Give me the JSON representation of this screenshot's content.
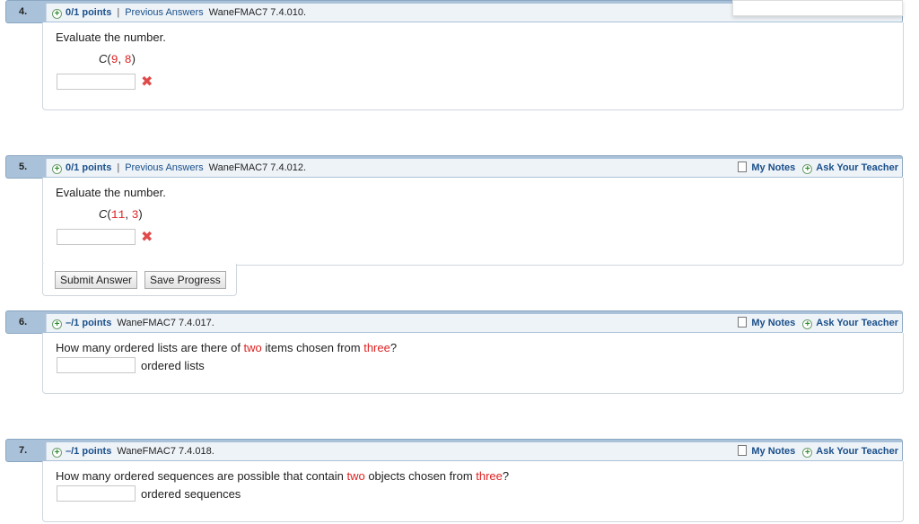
{
  "questions": [
    {
      "number": "4.",
      "points": "0/1 points",
      "separator": "|",
      "previous_answers": "Previous Answers",
      "code": "WaneFMAC7 7.4.010.",
      "prompt": "Evaluate the number.",
      "expr_fn": "C",
      "expr_open": "(",
      "expr_a": "9",
      "expr_comma": ", ",
      "expr_b": "8",
      "expr_close": ")",
      "answer_value": "",
      "status_mark": "✖"
    },
    {
      "number": "5.",
      "points": "0/1 points",
      "separator": "|",
      "previous_answers": "Previous Answers",
      "code": "WaneFMAC7 7.4.012.",
      "my_notes": "My Notes",
      "ask_teacher": "Ask Your Teacher",
      "prompt": "Evaluate the number.",
      "expr_fn": "C",
      "expr_open": "(",
      "expr_a": "11",
      "expr_comma": ", ",
      "expr_b": "3",
      "expr_close": ")",
      "answer_value": "",
      "status_mark": "✖",
      "submit_label": "Submit Answer",
      "save_label": "Save Progress"
    },
    {
      "number": "6.",
      "points": "–/1 points",
      "code": "WaneFMAC7 7.4.017.",
      "my_notes": "My Notes",
      "ask_teacher": "Ask Your Teacher",
      "prompt_start": "How many ordered lists are there of ",
      "prompt_red1": "two",
      "prompt_mid": " items chosen from ",
      "prompt_red2": "three",
      "prompt_end": "?",
      "answer_value": "",
      "unit": "ordered lists"
    },
    {
      "number": "7.",
      "points": "–/1 points",
      "code": "WaneFMAC7 7.4.018.",
      "my_notes": "My Notes",
      "ask_teacher": "Ask Your Teacher",
      "prompt_start": "How many ordered sequences are possible that contain ",
      "prompt_red1": "two",
      "prompt_mid": " objects chosen from ",
      "prompt_red2": "three",
      "prompt_end": "?",
      "answer_value": "",
      "unit": "ordered sequences"
    }
  ],
  "colors": {
    "header_bg": "#a9c2d9",
    "link": "#1a4f8a",
    "variable_red": "#dd2222",
    "error_mark": "#e04a4a"
  },
  "icons": [
    "plus-circle-icon",
    "note-icon",
    "x-mark-icon"
  ]
}
